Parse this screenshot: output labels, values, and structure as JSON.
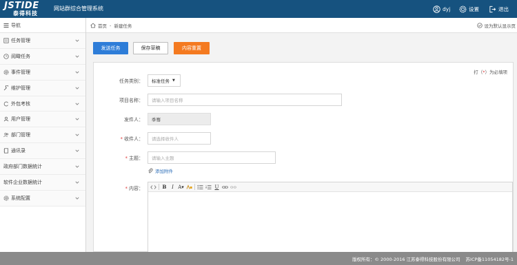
{
  "header": {
    "logo_main": "JSTIDE",
    "logo_sub": "泰得科技",
    "title": "网站群综合管理系统",
    "user": "dyj",
    "settings": "设置",
    "logout": "退出"
  },
  "sidebar": {
    "nav_label": "导航",
    "items": [
      {
        "label": "任务管理",
        "icon": "list-icon"
      },
      {
        "label": "阅瞰任务",
        "icon": "clock-icon"
      },
      {
        "label": "事件管理",
        "icon": "gear-icon"
      },
      {
        "label": "维护管理",
        "icon": "wrench-icon"
      },
      {
        "label": "外包考核",
        "icon": "circle-icon"
      },
      {
        "label": "用户管理",
        "icon": "user-icon"
      },
      {
        "label": "部门管理",
        "icon": "users-icon"
      },
      {
        "label": "通讯录",
        "icon": "book-icon"
      },
      {
        "label": "政府部门数据统计",
        "icon": ""
      },
      {
        "label": "软件企业数据统计",
        "icon": ""
      },
      {
        "label": "系统配置",
        "icon": "cog-icon"
      }
    ]
  },
  "breadcrumb": {
    "home": "首页",
    "separator": "-",
    "current": "新建任务",
    "default_page": "设为默认显示页"
  },
  "actions": {
    "send": "发送任务",
    "save_draft": "保存草稿",
    "reset": "内容重置"
  },
  "form": {
    "required_note_prefix": "打（",
    "required_note_star": "*",
    "required_note_suffix": "）为必填项",
    "task_type_label": "任务类别：",
    "task_type_value": "标准任务",
    "project_label": "项目名称：",
    "project_placeholder": "请输入项目名称",
    "sender_label": "发件人：",
    "sender_value": "季骞",
    "receiver_label": "收件人：",
    "receiver_placeholder": "请选择收件人",
    "subject_label": "主题：",
    "subject_placeholder": "请输入主题",
    "attach_label": "添加附件",
    "content_label": "内容：",
    "required_star": "*"
  },
  "footer": {
    "copyright": "版权所有：© 2000-2016 江苏泰得科技股份有限公司",
    "icp": "苏ICP备11054182号-1"
  },
  "colors": {
    "topbar": "#16527f",
    "primary": "#2e7dd8",
    "warning": "#f47a20",
    "required": "#e03a3a",
    "footer": "#8a8a8a"
  }
}
